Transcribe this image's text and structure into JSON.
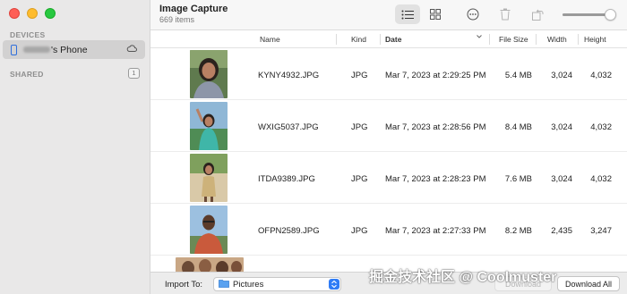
{
  "sidebar": {
    "devices_label": "DEVICES",
    "device_name_suffix": "'s Phone",
    "shared_label": "SHARED",
    "shared_badge": "1"
  },
  "toolbar": {
    "title": "Image Capture",
    "item_count": "669 items",
    "view_mode": "list",
    "thumbnail_size_fraction": 0.88
  },
  "table": {
    "columns": [
      "Name",
      "Kind",
      "Date",
      "File Size",
      "Width",
      "Height"
    ],
    "sorted_column": "Date",
    "rows": [
      {
        "name": "KYNY4932.JPG",
        "kind": "JPG",
        "date": "Mar 7, 2023 at 2:29:25 PM",
        "size": "5.4 MB",
        "width": "3,024",
        "height": "4,032"
      },
      {
        "name": "WXIG5037.JPG",
        "kind": "JPG",
        "date": "Mar 7, 2023 at 2:28:56 PM",
        "size": "8.4 MB",
        "width": "3,024",
        "height": "4,032"
      },
      {
        "name": "ITDA9389.JPG",
        "kind": "JPG",
        "date": "Mar 7, 2023 at 2:28:23 PM",
        "size": "7.6 MB",
        "width": "3,024",
        "height": "4,032"
      },
      {
        "name": "OFPN2589.JPG",
        "kind": "JPG",
        "date": "Mar 7, 2023 at 2:27:33 PM",
        "size": "8.2 MB",
        "width": "2,435",
        "height": "3,247"
      }
    ]
  },
  "bottom": {
    "import_label": "Import To:",
    "import_value": "Pictures",
    "download_label": "Download",
    "download_all_label": "Download All"
  },
  "watermark": "掘金技术社区 @ Coolmuster",
  "colors": {
    "accent": "#2f7cf6",
    "sidebar_bg": "#e9e8e8",
    "selected_row": "#d2d1d1"
  },
  "icons": [
    "list-view-icon",
    "grid-view-icon",
    "more-icon",
    "trash-icon",
    "rotate-icon",
    "phone-icon",
    "cloud-icon",
    "folder-icon",
    "chevron-updown-icon"
  ]
}
